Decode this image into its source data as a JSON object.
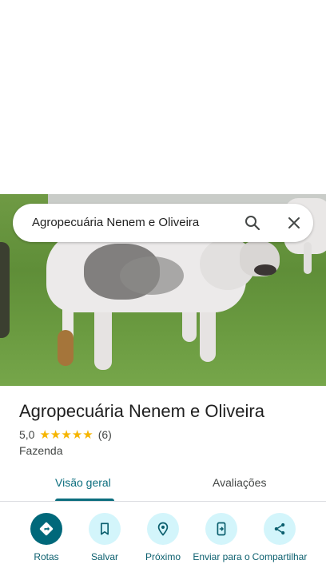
{
  "search": {
    "query": "Agropecuária Nenem e Oliveira"
  },
  "place": {
    "title": "Agropecuária Nenem e Oliveira",
    "rating": "5,0",
    "stars": 5,
    "review_count": "(6)",
    "category": "Fazenda"
  },
  "tabs": [
    {
      "label": "Visão geral",
      "active": true
    },
    {
      "label": "Avaliações",
      "active": false
    }
  ],
  "actions": [
    {
      "label": "Rotas",
      "icon": "directions-icon"
    },
    {
      "label": "Salvar",
      "icon": "bookmark-icon"
    },
    {
      "label": "Próximo",
      "icon": "nearby-icon"
    },
    {
      "label": "Enviar para o",
      "icon": "send-to-phone-icon"
    },
    {
      "label": "Compartilhar",
      "icon": "share-icon"
    }
  ],
  "colors": {
    "accent": "#0b6e7e",
    "primary_action": "#00687a",
    "action_bg": "#d3f5fb",
    "star": "#f6b500"
  }
}
